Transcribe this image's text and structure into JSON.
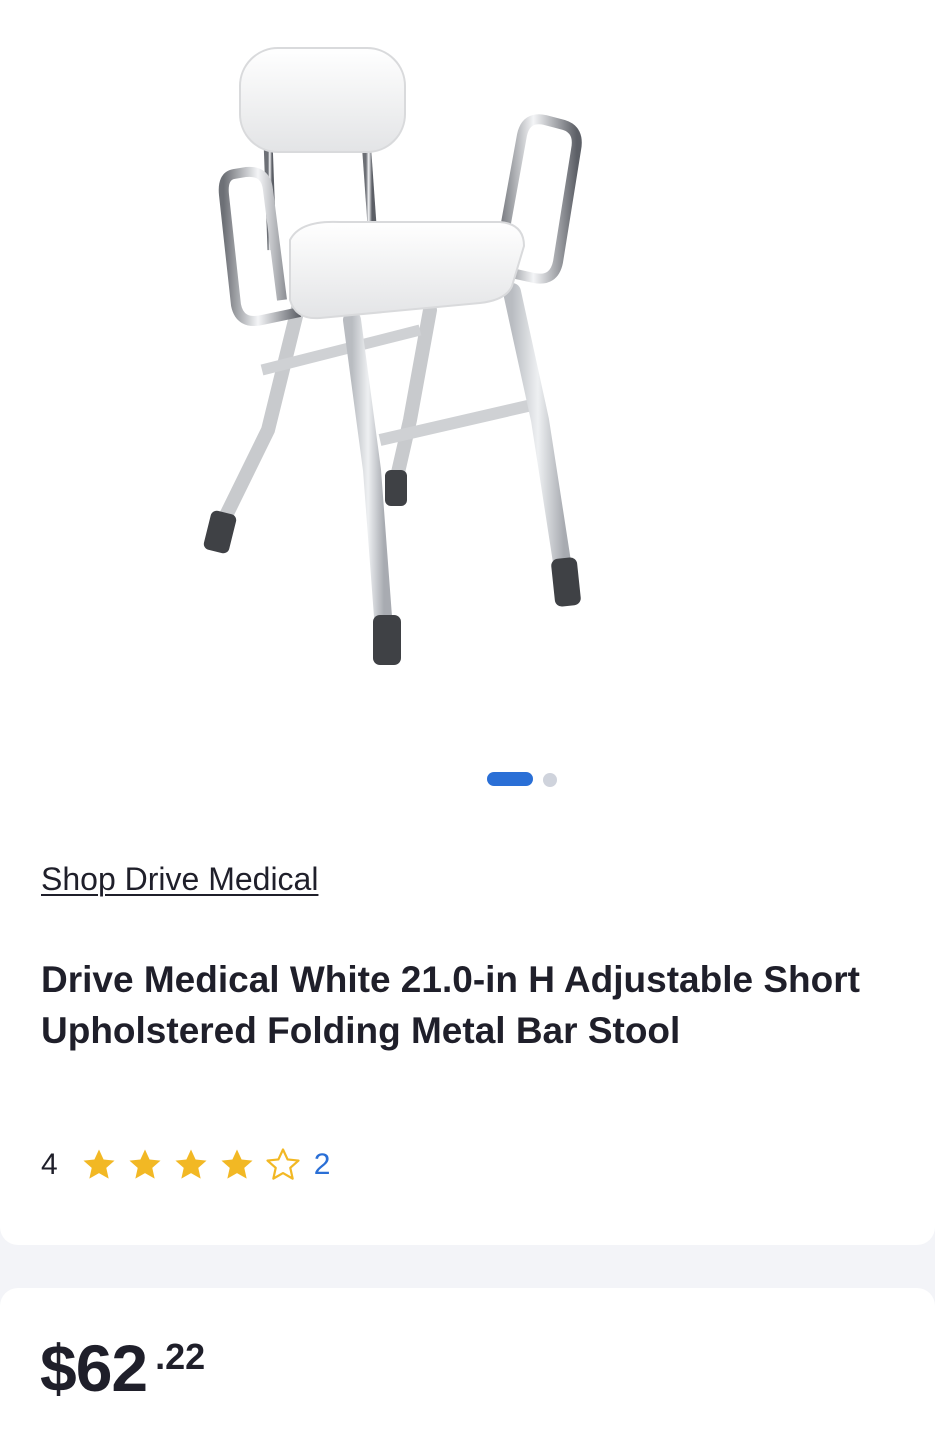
{
  "product": {
    "image_alt": "White adjustable stool with padded seat, backrest and chrome armrests",
    "gallery_pages": 2,
    "gallery_active_index": 0,
    "shop_link": "Shop Drive Medical",
    "title": "Drive Medical White 21.0-in H Adjustable Short Upholstered Folding Metal Bar Stool",
    "rating": {
      "value": "4",
      "stars_filled": 4,
      "stars_total": 5,
      "review_count": "2"
    },
    "price": {
      "dollars": "$62",
      "cents": ".22"
    }
  },
  "colors": {
    "accent": "#2a6fd6",
    "star": "#f2b824",
    "text": "#1f1f2a",
    "page_bg": "#f3f4f8"
  },
  "icons": {
    "star_filled": "star-filled-icon",
    "star_empty": "star-empty-icon"
  }
}
